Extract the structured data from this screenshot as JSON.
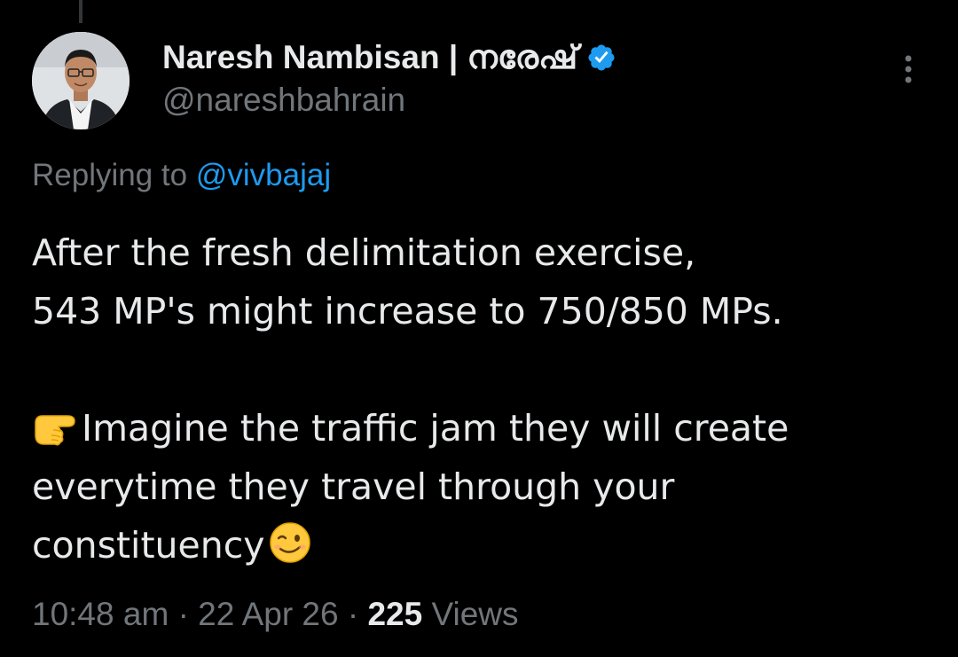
{
  "tweet": {
    "author": {
      "display_name": "Naresh Nambisan | നരേഷ്",
      "handle": "@nareshbahrain",
      "verified": true
    },
    "reply": {
      "prefix": "Replying to",
      "mention": "@vivbajaj"
    },
    "text": {
      "line1": "After the fresh delimitation exercise,",
      "line2": "543 MP's might increase to 750/850 MPs.",
      "line3": "Imagine the traffic jam they will create",
      "line4": "everytime they travel through your",
      "line5": "constituency"
    },
    "meta": {
      "time": "10:48 am",
      "separator": "·",
      "date": "22 Apr 26",
      "views_count": "225",
      "views_label": "Views"
    },
    "icons": {
      "verified": "verified-badge-icon",
      "more": "more-options-icon",
      "pointing": "backhand-index-pointing-right-emoji",
      "wink": "winking-face-emoji"
    },
    "colors": {
      "background": "#000000",
      "primary_text": "#e7e9ea",
      "secondary_text": "#71767b",
      "accent": "#1d9bf0"
    }
  }
}
